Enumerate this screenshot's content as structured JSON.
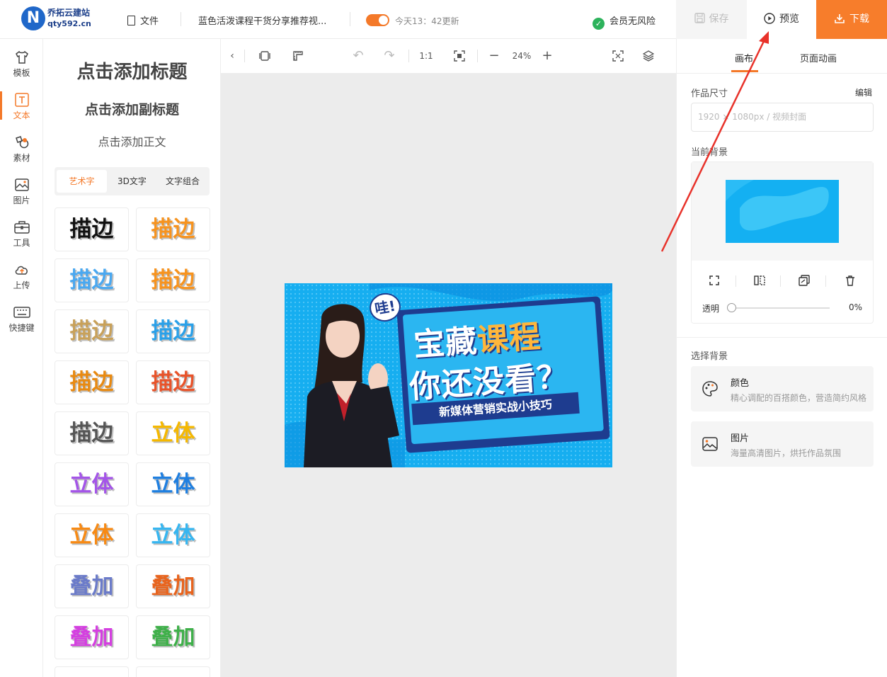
{
  "header": {
    "logo_letter": "N",
    "logo_title": "乔拓云建站",
    "logo_sub": "qty592.cn",
    "file_label": "文件",
    "doc_title": "蓝色活泼课程干货分享推荐视...",
    "autosave_text": "今天13：42更新",
    "member_text": "会员无风险",
    "save_label": "保存",
    "preview_label": "预览",
    "download_label": "下载"
  },
  "leftnav": {
    "items": [
      {
        "label": "模板"
      },
      {
        "label": "文本"
      },
      {
        "label": "素材"
      },
      {
        "label": "图片"
      },
      {
        "label": "工具"
      },
      {
        "label": "上传"
      },
      {
        "label": "快捷键"
      }
    ]
  },
  "textpanel": {
    "add_title": "点击添加标题",
    "add_subtitle": "点击添加副标题",
    "add_body": "点击添加正文",
    "tabs": [
      "艺术字",
      "3D文字",
      "文字组合"
    ],
    "tiles": [
      {
        "text": "描边",
        "color": "#111111"
      },
      {
        "text": "描边",
        "color": "#f7931e"
      },
      {
        "text": "描边",
        "color": "#4aa8f0"
      },
      {
        "text": "描边",
        "color": "#f7931e"
      },
      {
        "text": "描边",
        "color": "#c8a15a"
      },
      {
        "text": "描边",
        "color": "#2aa0e8"
      },
      {
        "text": "描边",
        "color": "#e88a12"
      },
      {
        "text": "描边",
        "color": "#e8532a"
      },
      {
        "text": "描边",
        "color": "#555555"
      },
      {
        "text": "立体",
        "color": "#f5b800"
      },
      {
        "text": "立体",
        "color": "#a455e8"
      },
      {
        "text": "立体",
        "color": "#1f7fe0"
      },
      {
        "text": "立体",
        "color": "#f78a14"
      },
      {
        "text": "立体",
        "color": "#37b6f0"
      },
      {
        "text": "叠加",
        "color": "#6b7bc9"
      },
      {
        "text": "叠加",
        "color": "#e8641e"
      },
      {
        "text": "叠加",
        "color": "#d43fe0"
      },
      {
        "text": "叠加",
        "color": "#3fb04a"
      }
    ]
  },
  "canvas_toolbar": {
    "ratio_label": "1:1",
    "zoom": "24%"
  },
  "banner": {
    "wa": "哇!",
    "line1_a": "宝藏",
    "line1_b": "课程",
    "line2": "你还没看？",
    "line3": "新媒体营销实战小技巧"
  },
  "rightpanel": {
    "tab_canvas": "画布",
    "tab_animation": "页面动画",
    "size_label": "作品尺寸",
    "edit_label": "编辑",
    "size_value": "1920 × 1080px   / 视频封面",
    "current_bg_label": "当前背景",
    "opacity_label": "透明",
    "opacity_value": "0%",
    "choose_bg_label": "选择背景",
    "options": [
      {
        "title": "颜色",
        "desc": "精心调配的百搭颜色，营造简约风格"
      },
      {
        "title": "图片",
        "desc": "海量高清图片，烘托作品氛围"
      }
    ]
  },
  "colors": {
    "accent": "#f47929",
    "banner_blue": "#16aef0",
    "banner_navy": "#1e3c8f",
    "banner_yellow": "#ffb63b",
    "arrow": "#e8322a"
  }
}
